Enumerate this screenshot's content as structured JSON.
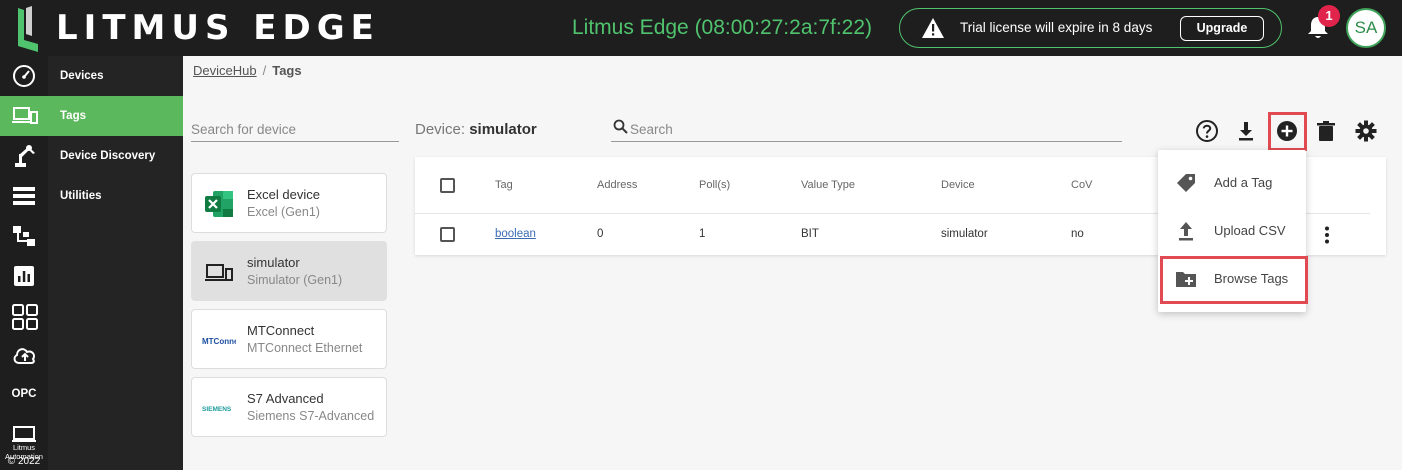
{
  "header": {
    "logo_text": "LITMUS EDGE",
    "device_id": "Litmus Edge (08:00:27:2a:7f:22)",
    "trial_message": "Trial license will expire in 8 days",
    "upgrade_label": "Upgrade",
    "notification_count": "1",
    "avatar_initials": "SA"
  },
  "rail": {
    "icons": [
      "dashboard-icon",
      "devices-icon",
      "robot-arm-icon",
      "list-icon",
      "flows-icon",
      "analytics-icon",
      "apps-grid-icon",
      "cloud-upload-icon"
    ],
    "opc_label": "OPC",
    "footer_label": "Litmus Automation",
    "copyright": "© 2022"
  },
  "nav": {
    "items": [
      {
        "label": "Devices",
        "active": false
      },
      {
        "label": "Tags",
        "active": true
      },
      {
        "label": "Device Discovery",
        "active": false
      },
      {
        "label": "Utilities",
        "active": false
      }
    ]
  },
  "breadcrumb": {
    "parent": "DeviceHub",
    "separator": "/",
    "current": "Tags"
  },
  "device_search": {
    "placeholder": "Search for device"
  },
  "devices": [
    {
      "name": "Excel device",
      "subtitle": "Excel (Gen1)",
      "icon": "excel-icon",
      "selected": false
    },
    {
      "name": "simulator",
      "subtitle": "Simulator (Gen1)",
      "icon": "simulator-icon",
      "selected": true
    },
    {
      "name": "MTConnect",
      "subtitle": "MTConnect Ethernet",
      "icon": "mtconnect-logo",
      "logo_text": "MTConnect",
      "selected": false
    },
    {
      "name": "S7 Advanced",
      "subtitle": "Siemens S7-Advanced",
      "icon": "siemens-logo",
      "logo_text": "SIEMENS",
      "selected": false
    }
  ],
  "main": {
    "device_label": "Device:",
    "device_name": "simulator",
    "search_placeholder": "Search",
    "toolbar_icons": [
      "help-icon",
      "download-icon",
      "add-circle-icon",
      "delete-icon",
      "settings-icon"
    ]
  },
  "table": {
    "columns": [
      "Tag",
      "Address",
      "Poll(s)",
      "Value Type",
      "Device",
      "CoV"
    ],
    "rows": [
      {
        "tag": "boolean",
        "address": "0",
        "poll": "1",
        "value_type": "BIT",
        "device": "simulator",
        "cov": "no"
      }
    ]
  },
  "add_menu": {
    "items": [
      {
        "label": "Add a Tag",
        "icon": "tag-icon"
      },
      {
        "label": "Upload CSV",
        "icon": "upload-icon"
      },
      {
        "label": "Browse Tags",
        "icon": "folder-plus-icon",
        "highlighted": true
      }
    ]
  },
  "colors": {
    "accent_green": "#5cb85c",
    "header_bg": "#1e1e1e",
    "highlight_red": "#e14a52",
    "notification_red": "#e0244b"
  }
}
